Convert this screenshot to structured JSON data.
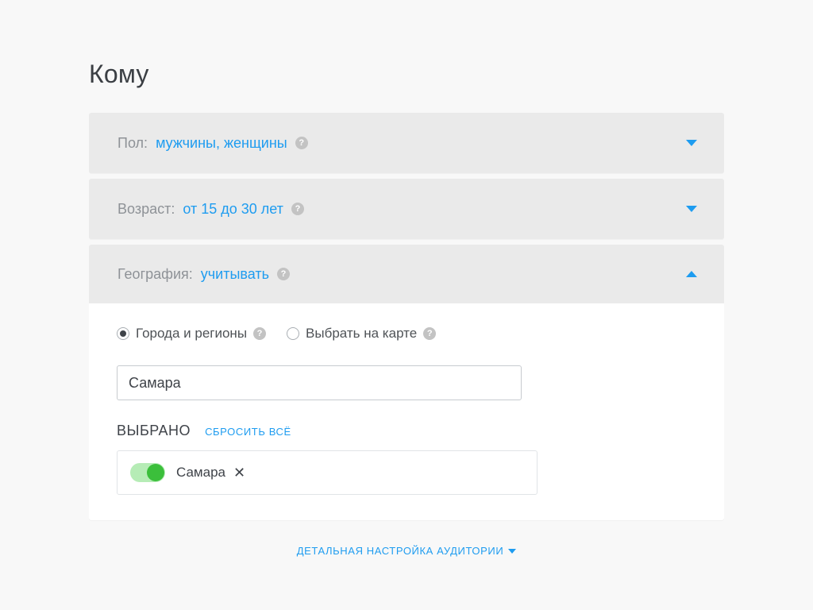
{
  "title": "Кому",
  "panels": {
    "gender": {
      "label": "Пол:",
      "value": "мужчины, женщины"
    },
    "age": {
      "label": "Возраст:",
      "value": "от 15 до 30 лет"
    },
    "geo": {
      "label": "География:",
      "value": "учитывать"
    }
  },
  "geo_body": {
    "radio_cities": "Города и регионы",
    "radio_map": "Выбрать на карте",
    "search_value": "Самара",
    "selected_title": "ВЫБРАНО",
    "reset": "СБРОСИТЬ ВСЁ",
    "item": {
      "name": "Самара"
    }
  },
  "footer": "ДЕТАЛЬНАЯ НАСТРОЙКА АУДИТОРИИ",
  "help_glyph": "?",
  "close_glyph": "✕"
}
